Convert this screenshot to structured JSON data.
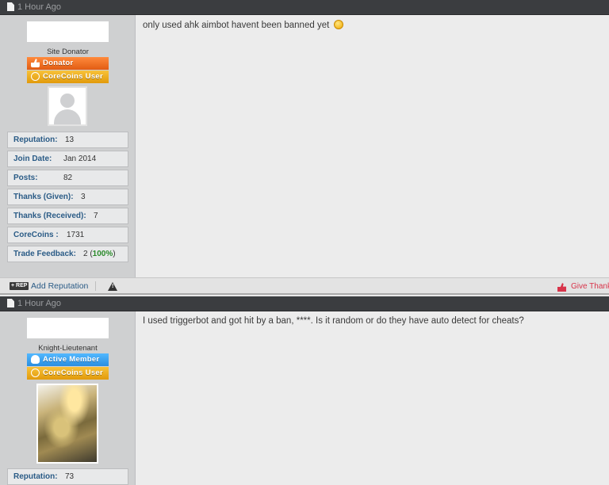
{
  "posts": [
    {
      "time": "1 Hour Ago",
      "usertitle": "Site Donator",
      "badges": [
        {
          "label": "Donator",
          "icon": "thumbs-up-icon",
          "color": "#e8672a"
        },
        {
          "label": "CoreCoins User",
          "icon": "coin-icon",
          "color": "#f0a91c"
        }
      ],
      "stats": [
        {
          "key": "Reputation:",
          "value": "13"
        },
        {
          "key": "Join Date:",
          "value": "Jan 2014"
        },
        {
          "key": "Posts:",
          "value": "82"
        },
        {
          "key": "Thanks (Given):",
          "value": "3"
        },
        {
          "key": "Thanks (Received):",
          "value": "7"
        },
        {
          "key": "CoreCoins :",
          "value": "1731"
        },
        {
          "key": "Trade Feedback:",
          "value": "2 (",
          "pct": "100%",
          "tail": ")"
        }
      ],
      "message": "only used ahk aimbot havent been banned yet"
    },
    {
      "time": "1 Hour Ago",
      "usertitle": "Knight-Lieutenant",
      "badges": [
        {
          "label": "Active Member",
          "icon": "lightbulb-icon",
          "color": "#3aa3f0"
        },
        {
          "label": "CoreCoins User",
          "icon": "coin-icon",
          "color": "#f0a91c"
        }
      ],
      "stats": [
        {
          "key": "Reputation:",
          "value": "73"
        }
      ],
      "message": "I used triggerbot and got hit by a ban, ****. Is it random or do they have auto detect for cheats?"
    }
  ],
  "footer": {
    "rep_tag": "+ REP",
    "add_reputation": "Add Reputation",
    "give_thanks": "Give Thank"
  }
}
